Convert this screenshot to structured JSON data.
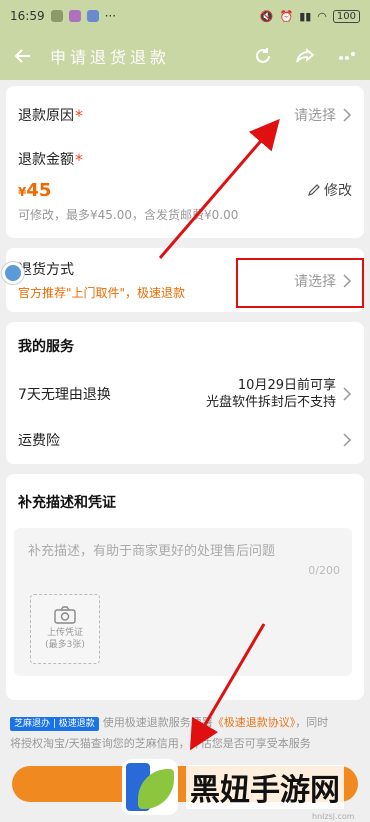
{
  "status_bar": {
    "time": "16:59",
    "battery": "100"
  },
  "nav": {
    "title": "申请退货退款"
  },
  "refund_reason": {
    "label": "退款原因",
    "required": "*",
    "value": "请选择"
  },
  "refund_amount": {
    "label": "退款金额",
    "required": "*",
    "currency": "¥",
    "amount": "45",
    "edit_label": "修改",
    "hint": "可修改，最多¥45.00，含发货邮费¥0.00"
  },
  "return_method": {
    "label": "退货方式",
    "note": "官方推荐\"上门取件\"，极速退款",
    "value": "请选择"
  },
  "services": {
    "title": "我的服务",
    "items": [
      {
        "label": "7天无理由退换",
        "value_line1": "10月29日前可享",
        "value_line2": "光盘软件拆封后不支持"
      },
      {
        "label": "运费险"
      }
    ]
  },
  "evidence": {
    "title": "补充描述和凭证",
    "placeholder": "补充描述，有助于商家更好的处理售后问题",
    "counter": "0/200",
    "upload_line1": "上传凭证",
    "upload_line2": "(最多3张)"
  },
  "footer": {
    "badge": "芝麻退办 | 极速退款",
    "text1": "使用极速退款服务须",
    "text_hidden": "署",
    "link": "《极速退款协议》",
    "text2": "，同时",
    "line2_a": "将授权淘宝/天猫查询您的芝麻信用",
    "line2_b": "，评估您是否可享受本服务"
  },
  "watermark": {
    "text": "黑妞手游网",
    "url": "hnlzsj.com"
  },
  "colors": {
    "header": "#c8d7a3",
    "accent": "#f06a00",
    "annotation": "#e01010"
  }
}
